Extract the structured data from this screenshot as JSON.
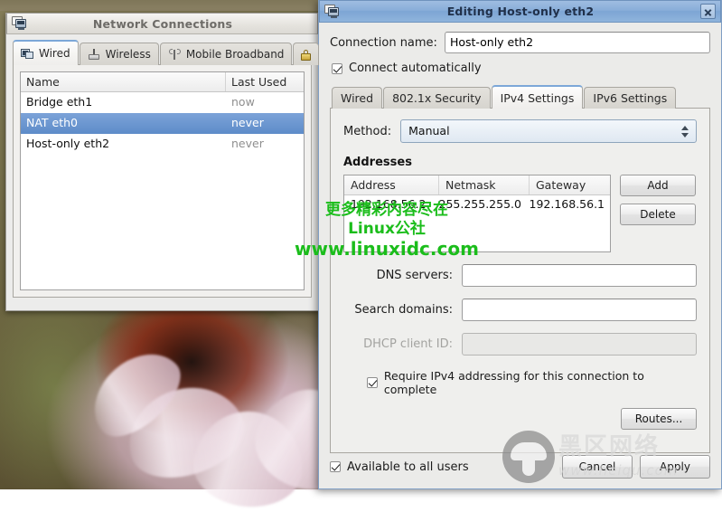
{
  "desktop": {
    "wallpaper_description": "coneflower-photo"
  },
  "network_connections_window": {
    "title": "Network Connections",
    "icon": "network-connections-icon",
    "tabs": [
      {
        "label": "Wired",
        "icon": "wired-icon",
        "active": true
      },
      {
        "label": "Wireless",
        "icon": "wireless-icon",
        "active": false
      },
      {
        "label": "Mobile Broadband",
        "icon": "mobile-broadband-icon",
        "active": false
      },
      {
        "label": "VPN",
        "icon": "vpn-lock-icon",
        "active": false
      }
    ],
    "list": {
      "columns": [
        "Name",
        "Last Used"
      ],
      "rows": [
        {
          "name": "Bridge eth1",
          "last_used": "now",
          "selected": false
        },
        {
          "name": "NAT eth0",
          "last_used": "never",
          "selected": true
        },
        {
          "name": "Host-only eth2",
          "last_used": "never",
          "selected": false
        }
      ]
    }
  },
  "editing_dialog": {
    "title": "Editing Host-only eth2",
    "icon": "connection-editor-icon",
    "close_label": "close-icon",
    "connection_name_label": "Connection name:",
    "connection_name_value": "Host-only eth2",
    "connect_automatically_label": "Connect automatically",
    "connect_automatically_checked": true,
    "tabs": [
      {
        "label": "Wired",
        "active": false
      },
      {
        "label": "802.1x Security",
        "active": false
      },
      {
        "label": "IPv4 Settings",
        "active": true
      },
      {
        "label": "IPv6 Settings",
        "active": false
      }
    ],
    "method_label": "Method:",
    "method_value": "Manual",
    "addresses_title": "Addresses",
    "addresses_columns": [
      "Address",
      "Netmask",
      "Gateway"
    ],
    "addresses_rows": [
      {
        "address": "192.168.56.2",
        "netmask": "255.255.255.0",
        "gateway": "192.168.56.1"
      }
    ],
    "add_button": "Add",
    "delete_button": "Delete",
    "dns_servers_label": "DNS servers:",
    "dns_servers_value": "",
    "search_domains_label": "Search domains:",
    "search_domains_value": "",
    "dhcp_client_id_label": "DHCP client ID:",
    "dhcp_client_id_value": "",
    "dhcp_client_id_disabled": true,
    "require_ipv4_label": "Require IPv4 addressing for this connection to complete",
    "require_ipv4_checked": true,
    "routes_button": "Routes...",
    "available_all_users_label": "Available to all users",
    "available_all_users_checked": true,
    "cancel_button": "Cancel",
    "apply_button": "Apply"
  },
  "watermarks": {
    "green": {
      "line1": "更多精彩内容尽在",
      "line2": "Linux公社",
      "line3": "www.linuxidc.com",
      "color": "#1bbd1b"
    },
    "heiqu": {
      "text": "黑区网络",
      "url": "www.heiqu.com"
    }
  }
}
